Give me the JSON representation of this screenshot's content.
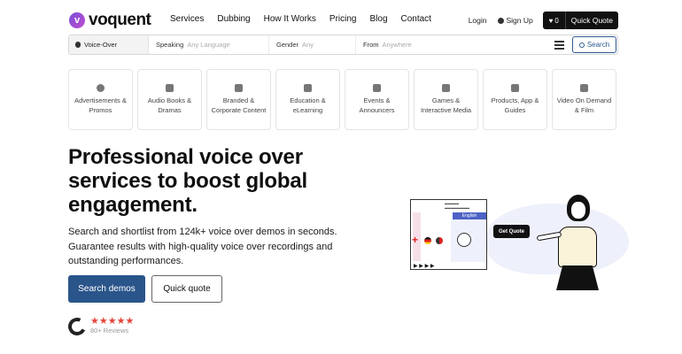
{
  "brand": {
    "name": "voquent",
    "mark": "v"
  },
  "nav": {
    "items": [
      "Services",
      "Dubbing",
      "How It Works",
      "Pricing",
      "Blog",
      "Contact"
    ],
    "login": "Login",
    "signup": "Sign Up",
    "favorites_count": "0",
    "quick_quote": "Quick Quote"
  },
  "search": {
    "voice_type": "Voice-Over",
    "speaking_label": "Speaking",
    "speaking_placeholder": "Any Language",
    "gender_label": "Gender",
    "gender_placeholder": "Any",
    "from_label": "From",
    "from_placeholder": "Anywhere",
    "button": "Search"
  },
  "categories": [
    "Advertisements & Promos",
    "Audio Books & Dramas",
    "Branded & Corporate Content",
    "Education & eLearning",
    "Events & Announcers",
    "Games & Interactive Media",
    "Products, App & Guides",
    "Video On Demand & Film"
  ],
  "hero": {
    "title": "Professional voice over services to boost global engagement.",
    "subtitle": "Search and shortlist from 124k+ voice over demos in seconds. Guarantee results with high-quality voice over recordings and outstanding performances.",
    "primary_button": "Search demos",
    "secondary_button": "Quick quote"
  },
  "reviews": {
    "stars": "★★★★★",
    "count": "80+ Reviews"
  },
  "illustration": {
    "language_bar": "English",
    "bubble": "Get Quote"
  },
  "colors": {
    "primary": "#2a558a",
    "accent_stars": "#e4453a",
    "brand_gradient_start": "#7a4dd8"
  }
}
